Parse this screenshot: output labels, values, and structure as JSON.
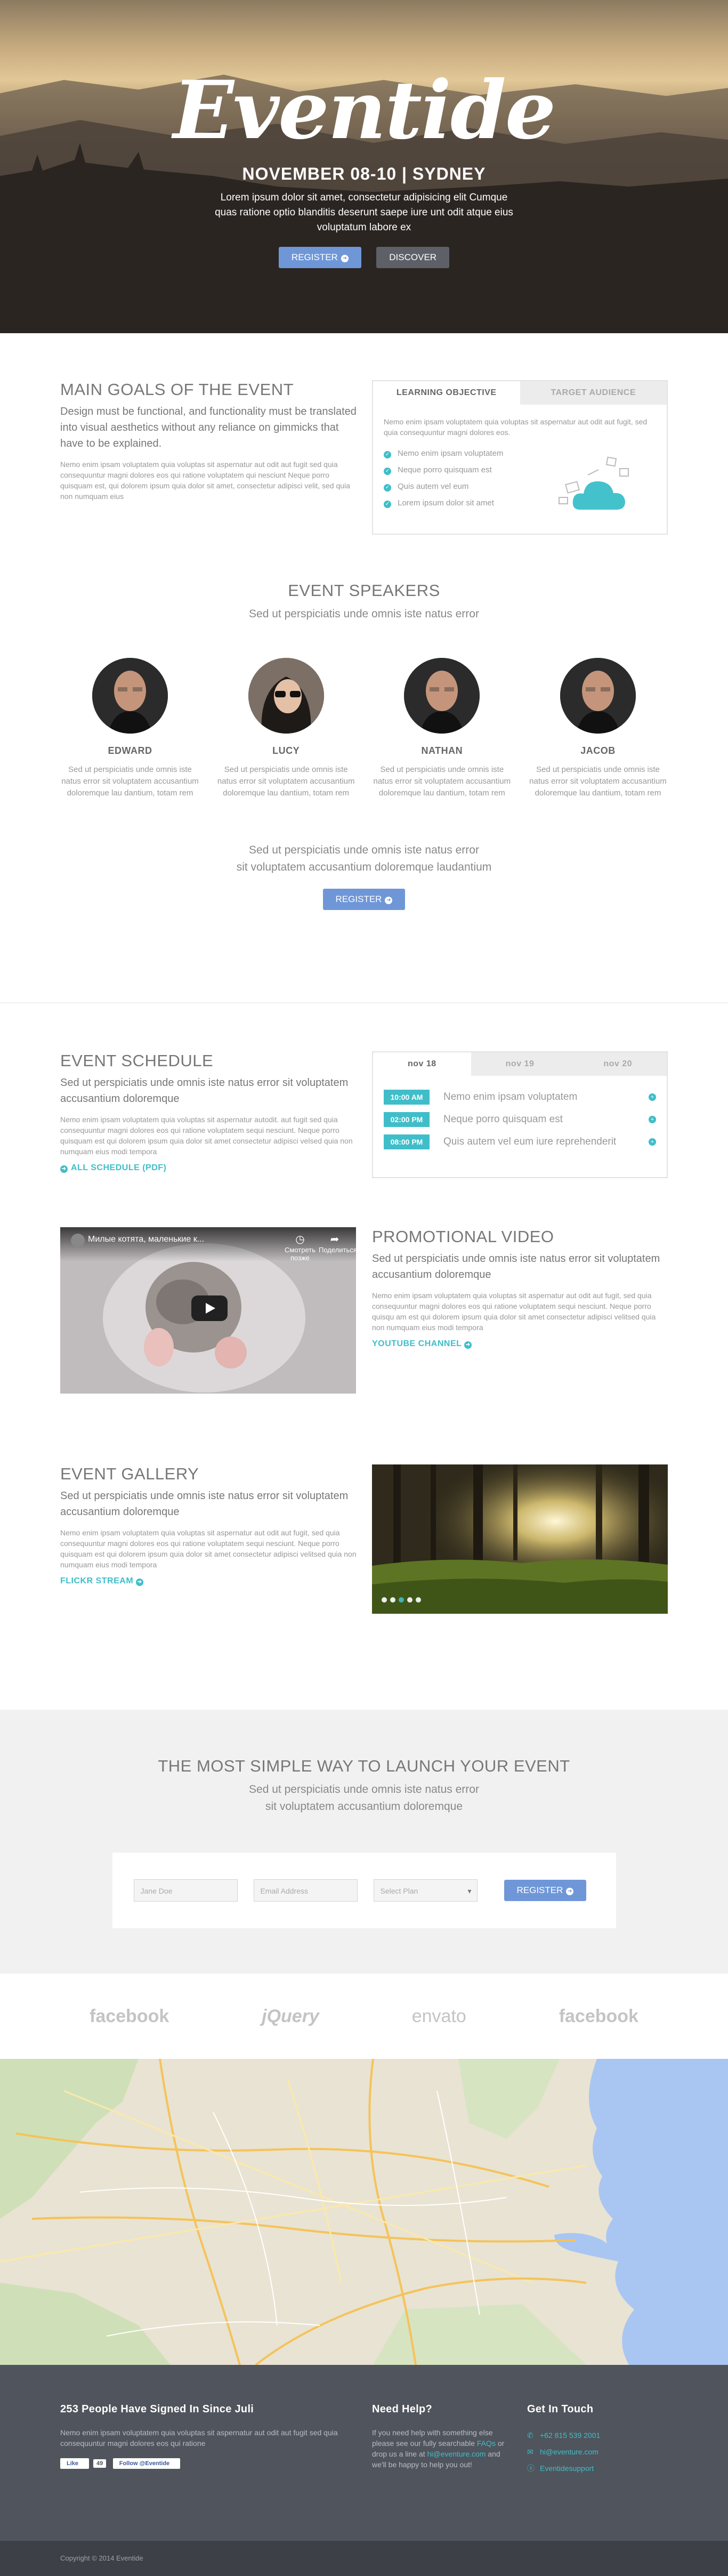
{
  "hero": {
    "logo": "Eventide",
    "date": "NOVEMBER 08-10 | SYDNEY",
    "lede": "Lorem ipsum dolor sit amet, consectetur adipisicing elit Cumque quas ratione optio blanditis deserunt saepe iure unt odit atque eius voluptatum labore ex",
    "register_label": "REGISTER",
    "discover_label": "DISCOVER"
  },
  "goals": {
    "title": "MAIN GOALS OF THE EVENT",
    "subtitle": "Design must be functional, and functionality must be translated into visual aesthetics without any reliance on gimmicks that have to be explained.",
    "body": "Nemo enim ipsam voluptatem quia voluptas sit aspernatur aut odit aut fugit sed quia consequuntur magni dolores eos qui ratione voluptatem qui nesciunt Neque porro quisquam est, qui dolorem ipsum quia dolor sit amet, consectetur adipisci velit, sed quia non numquam eius",
    "tabs": [
      {
        "label": "LEARNING OBJECTIVE"
      },
      {
        "label": "TARGET AUDIENCE"
      }
    ],
    "objective_text": "Nemo enim ipsam voluptatem quia voluptas sit aspernatur aut odit aut fugit, sed quia consequuntur magni dolores eos.",
    "objective_items": [
      "Nemo enim ipsam voluptatem",
      "Neque porro quisquam est",
      "Quis autem vel eum",
      "Lorem ipsum dolor sit amet"
    ]
  },
  "speakers": {
    "title": "EVENT SPEAKERS",
    "subtitle": "Sed ut perspiciatis unde omnis iste natus error",
    "people": [
      {
        "name": "EDWARD",
        "bio": "Sed ut perspiciatis unde omnis iste natus error sit voluptatem accusantium doloremque lau dantium, totam rem"
      },
      {
        "name": "LUCY",
        "bio": "Sed ut perspiciatis unde omnis iste natus error sit voluptatem accusantium doloremque lau dantium, totam rem"
      },
      {
        "name": "NATHAN",
        "bio": "Sed ut perspiciatis unde omnis iste natus error sit voluptatem accusantium doloremque lau dantium, totam rem"
      },
      {
        "name": "JACOB",
        "bio": "Sed ut perspiciatis unde omnis iste natus error sit voluptatem accusantium doloremque lau dantium, totam rem"
      }
    ],
    "join_line1": "Sed ut perspiciatis unde omnis iste natus error",
    "join_line2": "sit voluptatem accusantium doloremque laudantium",
    "register_label": "REGISTER"
  },
  "schedule": {
    "title": "EVENT SCHEDULE",
    "subtitle": "Sed ut perspiciatis unde omnis iste natus error sit voluptatem accusantium doloremque",
    "body": "Nemo enim ipsam voluptatem quia voluptas sit aspernatur autodit. aut fugit sed quia consequuntur magni dolores eos qui ratione voluptatem sequi nesciunt. Neque porro quisquam est qui dolorem ipsum quia dolor sit amet consectetur adipisci velsed quia non numquam eius modi tempora",
    "link": "ALL SCHEDULE (PDF)",
    "days": [
      {
        "label": "nov 18"
      },
      {
        "label": "nov 19"
      },
      {
        "label": "nov 20"
      }
    ],
    "items": [
      {
        "time": "10:00 AM",
        "title": "Nemo enim ipsam voluptatem"
      },
      {
        "time": "02:00 PM",
        "title": "Neque porro quisquam est"
      },
      {
        "time": "08:00 PM",
        "title": "Quis autem vel eum iure reprehenderit"
      }
    ]
  },
  "video": {
    "player_title": "Милые котята, маленькие к...",
    "watch_later": "Смотреть позже",
    "share": "Поделиться",
    "title": "PROMOTIONAL VIDEO",
    "subtitle": "Sed ut perspiciatis unde omnis iste natus error sit voluptatem accusantium doloremque",
    "body": "Nemo enim ipsam voluptatem quia voluptas sit aspernatur aut odit aut fugit, sed quia consequuntur magni dolores eos qui ratione voluptatem sequi nesciunt. Neque porro quisqu am est qui dolorem ipsum quia dolor sit amet consectetur adipisci velitsed quia non numquam eius modi tempora",
    "link": "YOUTUBE CHANNEL"
  },
  "gallery": {
    "title": "EVENT GALLERY",
    "subtitle": "Sed ut perspiciatis unde omnis iste natus error sit voluptatem accusantium doloremque",
    "body": "Nemo enim ipsam voluptatem quia voluptas sit aspernatur aut odit aut fugit, sed quia consequuntur magni dolores eos qui ratione voluptatem sequi nesciunt. Neque porro quisquam est qui dolorem ipsum quia dolor sit amet consectetur adipisci velitsed quia non numquam eius modi tempora",
    "link": "FLICKR STREAM"
  },
  "register": {
    "title": "THE MOST SIMPLE WAY TO LAUNCH YOUR EVENT",
    "line1": "Sed ut perspiciatis unde omnis iste natus error",
    "line2": "sit voluptatem accusantium doloremque",
    "name_placeholder": "Jane Doe",
    "email_placeholder": "Email Address",
    "plan_placeholder": "Select Plan",
    "submit_label": "REGISTER"
  },
  "partners": [
    "facebook",
    "jQuery",
    "envato",
    "facebook"
  ],
  "footer": {
    "signed_title": "253 People Have Signed In Since Juli",
    "signed_text": "Nemo enim ipsam voluptatem quia voluptas sit aspernatur aut odit aut fugit sed quia consequuntur magni dolores eos qui ratione",
    "like_label": "Like",
    "like_count": "49",
    "follow_label": "Follow @Eventide",
    "help_title": "Need Help?",
    "help_text1": "If you need help with something else please see our fully searchable",
    "help_faq": "FAQs",
    "help_text2": "or drop us a line at",
    "help_email": "hi@eventure.com",
    "help_text3": "and we'll be happy to help you out!",
    "contact_title": "Get In Touch",
    "phone": "+62 815 539 2001",
    "email": "hi@eventure.com",
    "skype": "Eventidesupport",
    "copyright": "Copyright © 2014 Eventide"
  },
  "colors": {
    "accent_teal": "#3fbec9",
    "button_blue": "#6f97d8",
    "footer_bg": "#50545c"
  }
}
